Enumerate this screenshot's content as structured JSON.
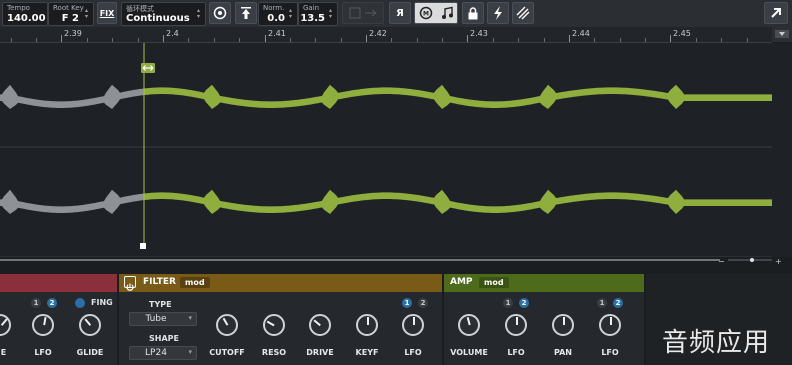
{
  "toolbar": {
    "tempo_label": "Tempo",
    "tempo_value": "140.00",
    "rootkey_label": "Root Key",
    "rootkey_value": "F 2",
    "fix_label": "FIX",
    "loopmode_label": "循环模式",
    "loopmode_value": "Continuous",
    "norm_label": "Norm.",
    "norm_value": "0.0",
    "gain_label": "Gain",
    "gain_value": "13.5",
    "reverse_label": "Я",
    "icons": [
      "target-icon",
      "upload-icon",
      "midi-icon",
      "note-icon",
      "lock-icon",
      "lightning-icon",
      "stripes-icon",
      "export-icon"
    ]
  },
  "ruler": {
    "labels": [
      "2.39",
      "2.4",
      "2.41",
      "2.42",
      "2.43",
      "2.44",
      "2.45"
    ]
  },
  "colors": {
    "waveform_active": "#8fae3e",
    "waveform_inactive": "#8e9196",
    "playhead": "#a6c43c",
    "filter_header": "#7a5a17",
    "amp_header": "#4d6b1a",
    "pitch_header": "#8b2f3a",
    "mod_active": "#2a6fa8"
  },
  "pitch_section": {
    "mod_nums": [
      "1",
      "2"
    ],
    "fing_label": "FING",
    "knob_labels": [
      "IE",
      "LFO",
      "GLIDE"
    ]
  },
  "filter_section": {
    "title": "FILTER",
    "mod_tag": "mod",
    "type_label": "TYPE",
    "type_value": "Tube",
    "shape_label": "SHAPE",
    "shape_value": "LP24",
    "mod_nums": [
      "1",
      "2"
    ],
    "knob_labels": [
      "CUTOFF",
      "RESO",
      "DRIVE",
      "KEYF",
      "LFO"
    ]
  },
  "amp_section": {
    "title": "AMP",
    "mod_tag": "mod",
    "mod_nums": [
      "1",
      "2"
    ],
    "knob_labels": [
      "VOLUME",
      "LFO",
      "PAN",
      "LFO"
    ]
  },
  "watermark": "音频应用"
}
